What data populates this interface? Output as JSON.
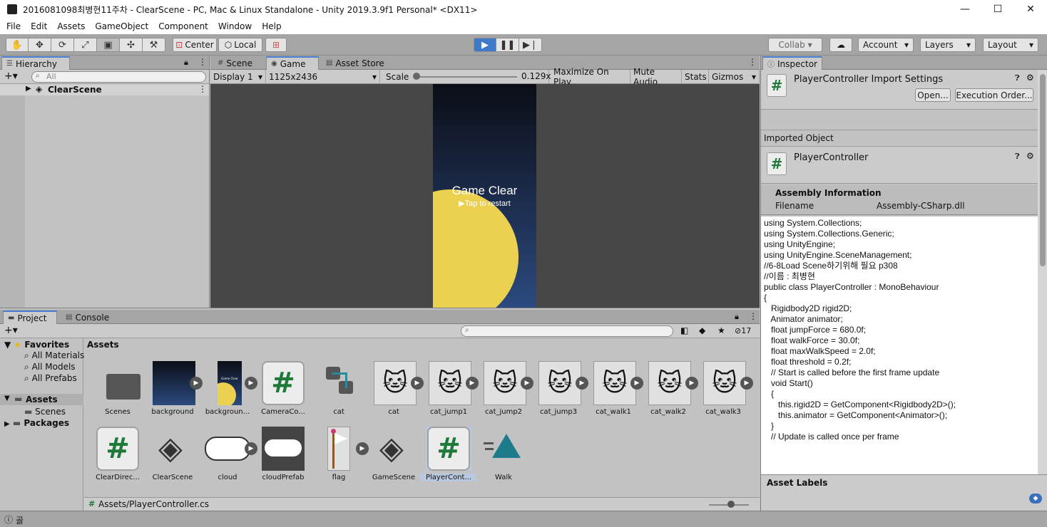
{
  "window": {
    "title": "2016081098최병현11주차 - ClearScene - PC, Mac & Linux Standalone - Unity 2019.3.9f1 Personal* <DX11>",
    "minimize": "—",
    "maximize": "☐",
    "close": "✕"
  },
  "menu": [
    "File",
    "Edit",
    "Assets",
    "GameObject",
    "Component",
    "Window",
    "Help"
  ],
  "toolbar": {
    "center_label": "Center",
    "local_label": "Local",
    "collab_label": "Collab ▾",
    "account_label": "Account",
    "layers_label": "Layers",
    "layout_label": "Layout"
  },
  "hierarchy": {
    "tab_label": "Hierarchy",
    "search_placeholder": "All",
    "scene_item": "ClearScene"
  },
  "scene_tabs": {
    "scene": "Scene",
    "game": "Game",
    "asset_store": "Asset Store"
  },
  "game_bar": {
    "display": "Display 1",
    "resolution": "1125x2436",
    "scale_label": "Scale",
    "scale_value": "0.129x",
    "scale_fraction": 0.0,
    "maximize": "Maximize On Play",
    "mute": "Mute Audio",
    "stats": "Stats",
    "gizmos": "Gizmos"
  },
  "game_view": {
    "title": "Game Clear",
    "subtitle": "▶Tap to restart"
  },
  "project": {
    "tab_project": "Project",
    "tab_console": "Console",
    "hidden_count": "17",
    "favorites_label": "Favorites",
    "favorites": [
      "All Materials",
      "All Models",
      "All Prefabs"
    ],
    "assets_label": "Assets",
    "assets_children": [
      "Scenes"
    ],
    "packages_label": "Packages",
    "breadcrumb": "Assets",
    "path": "Assets/PlayerController.cs",
    "row1": [
      "Scenes",
      "background",
      "backgroun...",
      "CameraCo...",
      "cat",
      "cat",
      "cat_jump1",
      "cat_jump2",
      "cat_jump3",
      "cat_walk1",
      "cat_walk2",
      "cat_walk3"
    ],
    "row2": [
      "ClearDirec...",
      "ClearScene",
      "cloud",
      "cloudPrefab",
      "flag",
      "GameScene",
      "PlayerCont...",
      "Walk"
    ],
    "preview_mini_text": "Game Clear"
  },
  "inspector": {
    "tab_label": "Inspector",
    "title": "PlayerController Import Settings",
    "open_btn": "Open...",
    "exec_btn": "Execution Order...",
    "imported_label": "Imported Object",
    "object_name": "PlayerController",
    "assembly_header": "Assembly Information",
    "filename_label": "Filename",
    "filename_value": "Assembly-CSharp.dll",
    "asset_labels": "Asset Labels",
    "code": [
      "using System.Collections;",
      "using System.Collections.Generic;",
      "using UnityEngine;",
      "using UnityEngine.SceneManagement;",
      "//6-8Load Scene하기위해 필요 p308",
      "//이름 : 최병현",
      "",
      "public class PlayerController : MonoBehaviour",
      "{",
      "   Rigidbody2D rigid2D;",
      "   Animator animator;",
      "   float jumpForce = 680.0f;",
      "   float walkForce = 30.0f;",
      "   float maxWalkSpeed = 2.0f;",
      "   float threshold = 0.2f;",
      "",
      "   // Start is called before the first frame update",
      "   void Start()",
      "   {",
      "      this.rigid2D = GetComponent<Rigidbody2D>();",
      "      this.animator = GetComponent<Animator>();",
      "   }",
      "",
      "   // Update is called once per frame"
    ]
  },
  "statusbar": {
    "text": "골"
  },
  "colors": {
    "accent": "#4a7fd0",
    "play_active": "#3f79c7",
    "game_bg_top": "#0b0e16",
    "game_bg_bottom": "#2b4a7e",
    "sun": "#ecd04f",
    "csharp_green": "#1f7a3a"
  }
}
